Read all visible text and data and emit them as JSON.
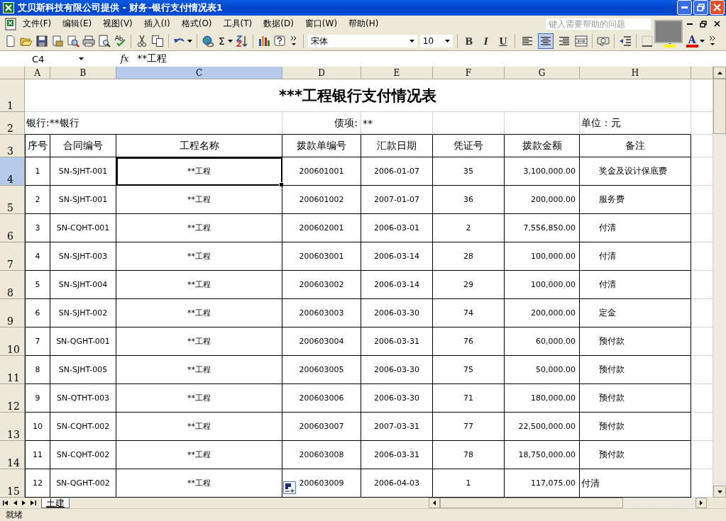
{
  "window": {
    "title": "艾贝斯科技有限公司提供 - 财务-银行支付情况表1"
  },
  "menu": [
    "文件(F)",
    "编辑(E)",
    "视图(V)",
    "插入(I)",
    "格式(O)",
    "工具(T)",
    "数据(D)",
    "窗口(W)",
    "帮助(H)"
  ],
  "help_box": {
    "placeholder": "键入需要帮助的问题"
  },
  "toolbar": {
    "sum": "Σ",
    "font": "宋体",
    "size": "10",
    "format_buttons": [
      {
        "label": "B",
        "kind": "bold"
      },
      {
        "label": "I",
        "kind": "italic"
      },
      {
        "label": "U",
        "kind": "underline"
      }
    ],
    "align_buttons": [
      {
        "kind": "left",
        "selected": false
      },
      {
        "kind": "center",
        "selected": true
      },
      {
        "kind": "right",
        "selected": false
      }
    ],
    "font_color_label": "A"
  },
  "formula_bar": {
    "name_box": "C4",
    "fx": "fx",
    "value": "**工程"
  },
  "columns": [
    {
      "label": "A",
      "selected": false
    },
    {
      "label": "B",
      "selected": false
    },
    {
      "label": "C",
      "selected": true
    },
    {
      "label": "D",
      "selected": false
    },
    {
      "label": "E",
      "selected": false
    },
    {
      "label": "F",
      "selected": false
    },
    {
      "label": "G",
      "selected": false
    },
    {
      "label": "H",
      "selected": false
    }
  ],
  "header_row_labels": [
    "1",
    "2",
    "3"
  ],
  "sheet": {
    "title": "***工程银行支付情况表",
    "bank": "银行:**银行",
    "item_label": "债项:",
    "item_value": "**",
    "unit": "单位：元",
    "headers": [
      "序号",
      "合同编号",
      "工程名称",
      "拨款单编号",
      "汇款日期",
      "凭证号",
      "拨款金额",
      "备注"
    ]
  },
  "rows": [
    {
      "row_label": "4",
      "selected": true,
      "remark_indented": true,
      "cells": [
        "1",
        "SN-SJHT-001",
        "**工程",
        "200601001",
        "2006-01-07",
        "35",
        "3,100,000.00",
        "奖金及设计保底费"
      ]
    },
    {
      "row_label": "5",
      "selected": false,
      "remark_indented": true,
      "cells": [
        "2",
        "SN-SJHT-001",
        "**工程",
        "200601002",
        "2007-01-07",
        "36",
        "200,000.00",
        "服务费"
      ]
    },
    {
      "row_label": "6",
      "selected": false,
      "remark_indented": true,
      "cells": [
        "3",
        "SN-CQHT-001",
        "**工程",
        "200602001",
        "2006-03-01",
        "2",
        "7,556,850.00",
        "付清"
      ]
    },
    {
      "row_label": "7",
      "selected": false,
      "remark_indented": true,
      "cells": [
        "4",
        "SN-SJHT-003",
        "**工程",
        "200603001",
        "2006-03-14",
        "28",
        "100,000.00",
        "付清"
      ]
    },
    {
      "row_label": "8",
      "selected": false,
      "remark_indented": true,
      "cells": [
        "5",
        "SN-SJHT-004",
        "**工程",
        "200603002",
        "2006-03-14",
        "29",
        "100,000.00",
        "付清"
      ]
    },
    {
      "row_label": "9",
      "selected": false,
      "remark_indented": true,
      "cells": [
        "6",
        "SN-SJHT-002",
        "**工程",
        "200603003",
        "2006-03-30",
        "74",
        "200,000.00",
        "定金"
      ]
    },
    {
      "row_label": "10",
      "selected": false,
      "remark_indented": true,
      "cells": [
        "7",
        "SN-QGHT-001",
        "**工程",
        "200603004",
        "2006-03-31",
        "76",
        "60,000.00",
        "预付款"
      ]
    },
    {
      "row_label": "11",
      "selected": false,
      "remark_indented": true,
      "cells": [
        "8",
        "SN-SJHT-005",
        "**工程",
        "200603005",
        "2006-03-30",
        "75",
        "50,000.00",
        "预付款"
      ]
    },
    {
      "row_label": "12",
      "selected": false,
      "remark_indented": true,
      "cells": [
        "9",
        "SN-QTHT-003",
        "**工程",
        "200603006",
        "2006-03-30",
        "71",
        "180,000.00",
        "预付款"
      ]
    },
    {
      "row_label": "13",
      "selected": false,
      "remark_indented": true,
      "cells": [
        "10",
        "SN-CQHT-002",
        "**工程",
        "200603007",
        "2007-03-31",
        "77",
        "22,500,000.00",
        "预付款"
      ]
    },
    {
      "row_label": "14",
      "selected": false,
      "remark_indented": true,
      "cells": [
        "11",
        "SN-CQHT-002",
        "**工程",
        "200603008",
        "2006-03-31",
        "78",
        "18,750,000.00",
        "预付款"
      ]
    },
    {
      "row_label": "15",
      "selected": false,
      "remark_indented": false,
      "cells": [
        "12",
        "SN-QGHT-002",
        "**工程",
        "200603009",
        "2006-04-03",
        "1",
        "117,075.00",
        "付清"
      ]
    }
  ],
  "sheet_tabs": [
    {
      "label": "土建",
      "selected": true
    }
  ],
  "status_bar": "就绪"
}
